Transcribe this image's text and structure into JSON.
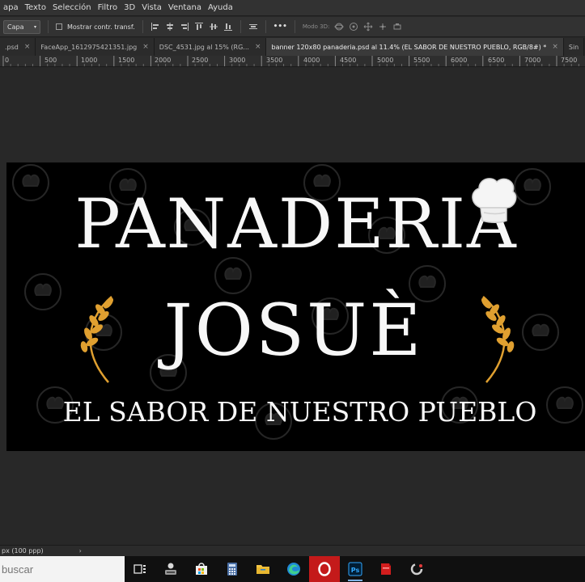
{
  "menubar": {
    "items": [
      "apa",
      "Texto",
      "Selección",
      "Filtro",
      "3D",
      "Vista",
      "Ventana",
      "Ayuda"
    ]
  },
  "options": {
    "layer_select": "Capa",
    "show_transform_label": "Mostrar contr. transf.",
    "more_label": "•••",
    "mode3d_label": "Modo 3D:"
  },
  "tabs": [
    {
      "label": ".psd",
      "active": false
    },
    {
      "label": "FaceApp_1612975421351.jpg",
      "active": false
    },
    {
      "label": "DSC_4531.jpg al 15% (RG...",
      "active": false
    },
    {
      "label": "banner 120x80 panaderia.psd al 11.4% (EL SABOR DE NUESTRO PUEBLO, RGB/8#) *",
      "active": true
    },
    {
      "label": "Sin",
      "active": false
    }
  ],
  "ruler": {
    "labels": [
      "0",
      "500",
      "1000",
      "1500",
      "2000",
      "2500",
      "3000",
      "3500",
      "4000",
      "4500",
      "5000",
      "5500",
      "6000",
      "6500",
      "7000",
      "7500"
    ]
  },
  "banner": {
    "title_line1": "PANADERIA",
    "title_line2": "JOSUÈ",
    "tagline": "EL SABOR DE NUESTRO PUEBLO",
    "accent_color": "#e0a030",
    "text_color": "#f7f7f7",
    "background_color": "#000000"
  },
  "statusbar": {
    "resolution": "px (100 ppp)",
    "arrow": "›"
  },
  "taskbar": {
    "search_placeholder": "buscar",
    "icons": [
      "task-view-icon",
      "user-tool-icon",
      "store-icon",
      "calculator-icon",
      "file-explorer-icon",
      "edge-icon",
      "opera-icon",
      "photoshop-icon",
      "red-app-icon",
      "loading-app-icon"
    ],
    "photoshop_label": "Ps"
  },
  "colors": {
    "ui_bg": "#323232",
    "workspace_bg": "#282828",
    "active_indicator": "#7fb2e5"
  }
}
